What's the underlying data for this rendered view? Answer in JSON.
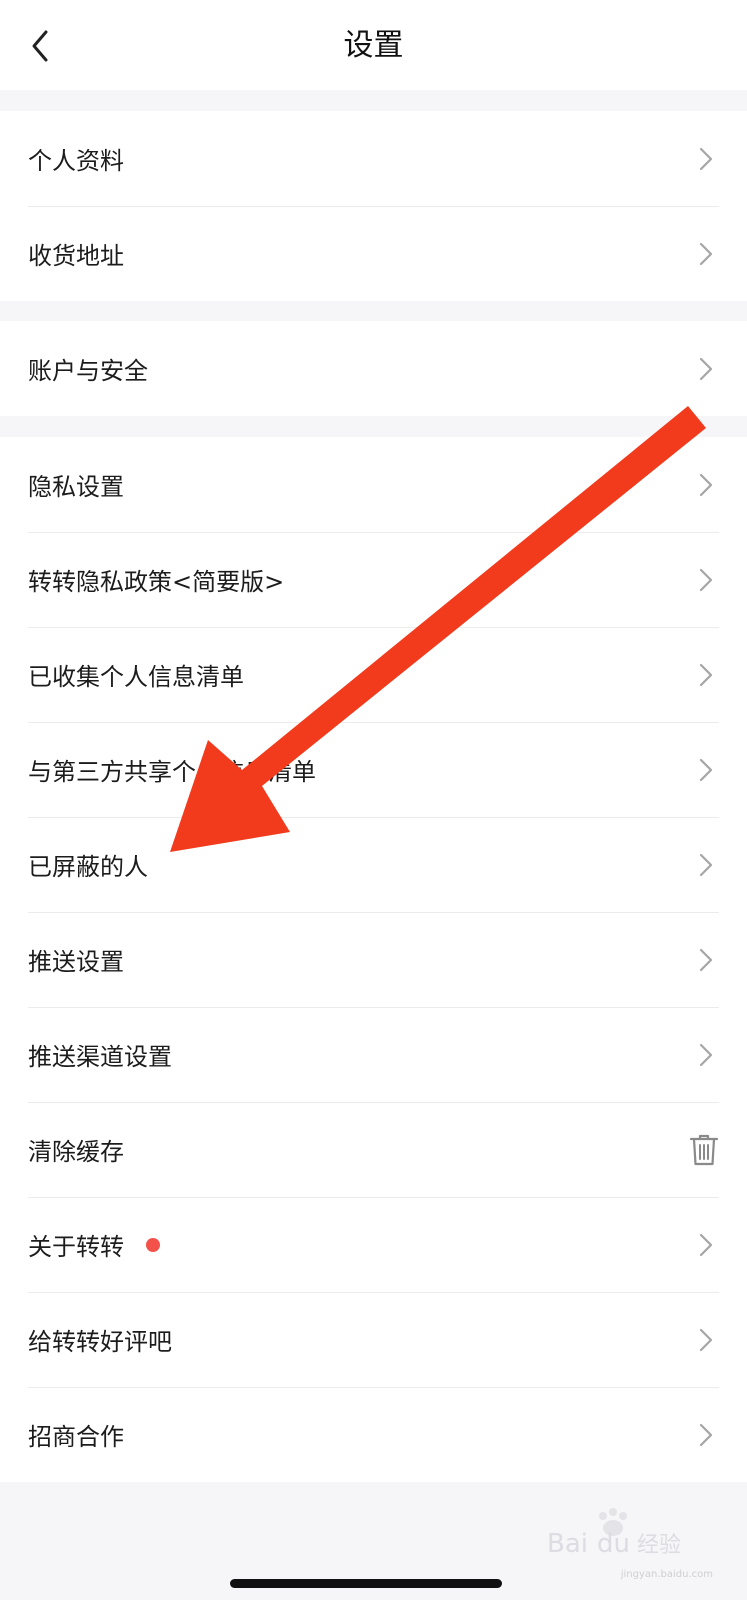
{
  "header": {
    "title": "设置",
    "back_icon": "chevron-left-icon"
  },
  "groups": [
    {
      "items": [
        {
          "label": "个人资料",
          "icon": "chevron-right-icon"
        },
        {
          "label": "收货地址",
          "icon": "chevron-right-icon"
        }
      ]
    },
    {
      "items": [
        {
          "label": "账户与安全",
          "icon": "chevron-right-icon"
        }
      ]
    },
    {
      "items": [
        {
          "label": "隐私设置",
          "icon": "chevron-right-icon"
        },
        {
          "label": "转转隐私政策<简要版>",
          "icon": "chevron-right-icon"
        },
        {
          "label": "已收集个人信息清单",
          "icon": "chevron-right-icon"
        },
        {
          "label": "与第三方共享个人信息清单",
          "icon": "chevron-right-icon"
        },
        {
          "label": "已屏蔽的人",
          "icon": "chevron-right-icon"
        },
        {
          "label": "推送设置",
          "icon": "chevron-right-icon"
        },
        {
          "label": "推送渠道设置",
          "icon": "chevron-right-icon"
        },
        {
          "label": "清除缓存",
          "icon": "trash-icon"
        },
        {
          "label": "关于转转",
          "icon": "chevron-right-icon",
          "badge": "red-dot"
        },
        {
          "label": "给转转好评吧",
          "icon": "chevron-right-icon"
        },
        {
          "label": "招商合作",
          "icon": "chevron-right-icon"
        }
      ]
    }
  ],
  "overlay": {
    "arrow_color": "#f23a1d",
    "arrow_icon": "annotation-arrow"
  },
  "watermark": {
    "logo": "Baidu经验",
    "url": "jingyan.baidu.com"
  },
  "colors": {
    "background": "#f6f6f8",
    "card": "#ffffff",
    "divider": "#ececec",
    "badge_red": "#f2524a"
  }
}
